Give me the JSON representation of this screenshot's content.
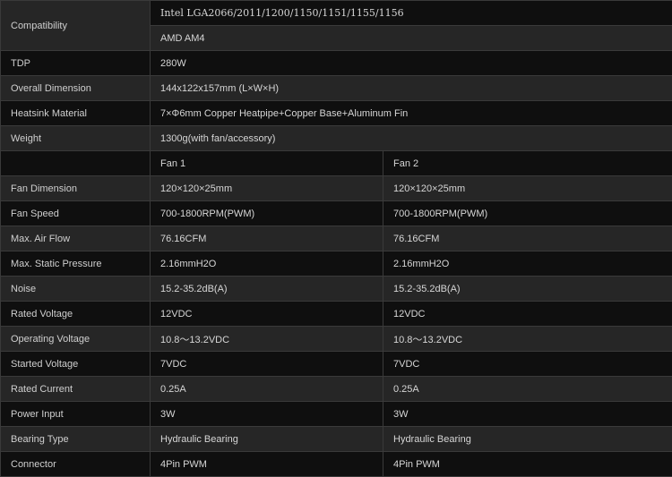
{
  "compatibility": {
    "label": "Compatibility",
    "intel": "Intel LGA2066/2011/1200/1150/1151/1155/1156",
    "amd": "AMD AM4"
  },
  "tdp": {
    "label": "TDP",
    "value": "280W"
  },
  "overall_dimension": {
    "label": "Overall Dimension",
    "value": "144x122x157mm (L×W×H)"
  },
  "heatsink_material": {
    "label": "Heatsink Material",
    "value": "7×Φ6mm Copper Heatpipe+Copper Base+Aluminum Fin"
  },
  "weight": {
    "label": "Weight",
    "value": "1300g(with fan/accessory)"
  },
  "fan_header": {
    "fan1": "Fan 1",
    "fan2": "Fan 2"
  },
  "fan_rows": [
    {
      "label": "Fan Dimension",
      "fan1": "120×120×25mm",
      "fan2": "120×120×25mm"
    },
    {
      "label": "Fan Speed",
      "fan1": "700-1800RPM(PWM)",
      "fan2": "700-1800RPM(PWM)"
    },
    {
      "label": "Max. Air Flow",
      "fan1": "76.16CFM",
      "fan2": "76.16CFM"
    },
    {
      "label": "Max. Static Pressure",
      "fan1": "2.16mmH2O",
      "fan2": "2.16mmH2O"
    },
    {
      "label": "Noise",
      "fan1": "15.2-35.2dB(A)",
      "fan2": "15.2-35.2dB(A)"
    },
    {
      "label": "Rated Voltage",
      "fan1": "12VDC",
      "fan2": "12VDC"
    },
    {
      "label": "Operating Voltage",
      "fan1": "10.8～13.2VDC",
      "fan2": "10.8～13.2VDC"
    },
    {
      "label": "Started Voltage",
      "fan1": "7VDC",
      "fan2": "7VDC"
    },
    {
      "label": "Rated Current",
      "fan1": "0.25A",
      "fan2": "0.25A"
    },
    {
      "label": "Power Input",
      "fan1": "3W",
      "fan2": "3W"
    },
    {
      "label": "Bearing Type",
      "fan1": "Hydraulic Bearing",
      "fan2": "Hydraulic Bearing"
    },
    {
      "label": "Connector",
      "fan1": "4Pin PWM",
      "fan2": "4Pin PWM"
    }
  ]
}
